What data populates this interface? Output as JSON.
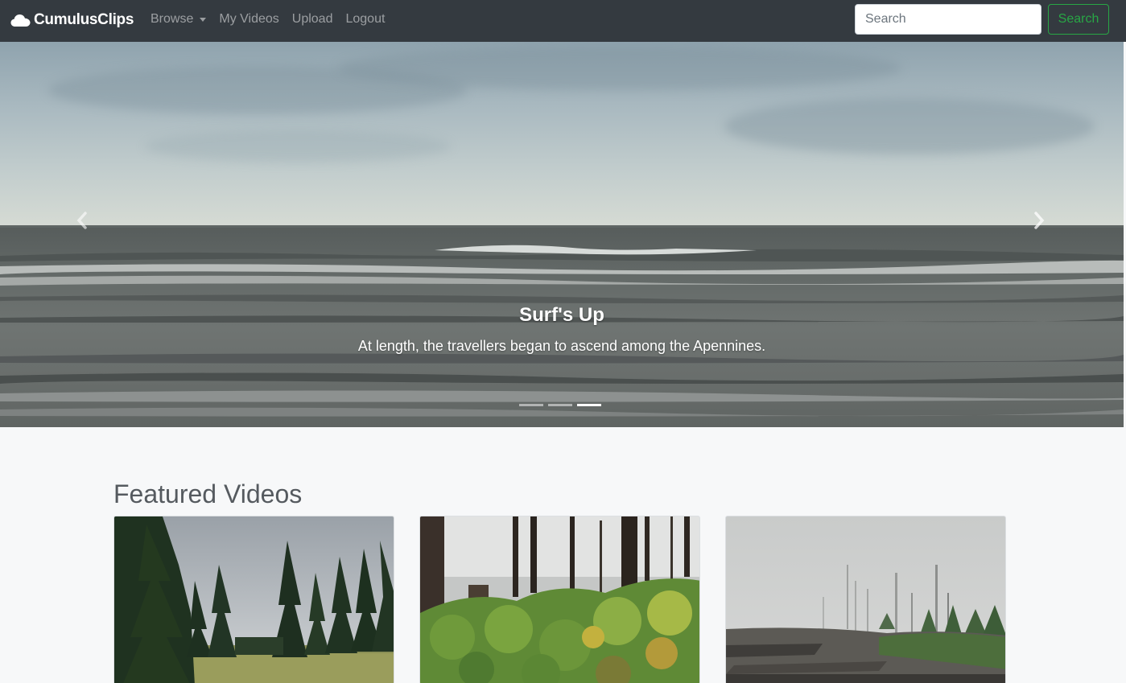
{
  "navbar": {
    "brand": "CumulusClips",
    "links": [
      {
        "label": "Browse",
        "dropdown": true
      },
      {
        "label": "My Videos"
      },
      {
        "label": "Upload"
      },
      {
        "label": "Logout"
      }
    ],
    "search_placeholder": "Search",
    "search_button": "Search"
  },
  "carousel": {
    "title": "Surf's Up",
    "text": "At length, the travellers began to ascend among the Apennines.",
    "slide_count": 3,
    "active_index": 2
  },
  "featured": {
    "heading": "Featured Videos",
    "videos": [
      {
        "thumbnail": "forest-meadow"
      },
      {
        "thumbnail": "burnt-trees-leaves"
      },
      {
        "thumbnail": "foggy-burnt-forest"
      }
    ]
  },
  "colors": {
    "navbar_bg": "#343a40",
    "accent_green": "#28a745",
    "page_bg": "#f7f8f9"
  }
}
